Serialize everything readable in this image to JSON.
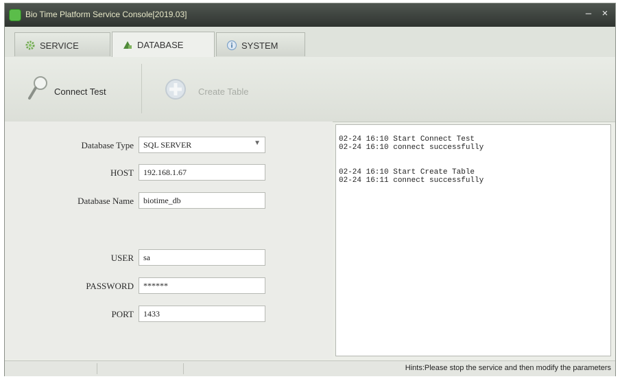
{
  "window": {
    "title": "Bio Time Platform Service Console[2019.03]",
    "minimize_glyph": "–",
    "close_glyph": "×"
  },
  "tabs": [
    {
      "label": "SERVICE",
      "icon": "gear-icon"
    },
    {
      "label": "DATABASE",
      "icon": "database-icon",
      "active": true
    },
    {
      "label": "SYSTEM",
      "icon": "info-icon"
    }
  ],
  "toolbar": {
    "connect_test": "Connect Test",
    "create_table": "Create Table"
  },
  "form": {
    "db_type": {
      "label": "Database Type",
      "value": "SQL SERVER"
    },
    "host": {
      "label": "HOST",
      "value": "192.168.1.67"
    },
    "db_name": {
      "label": "Database Name",
      "value": "biotime_db"
    },
    "user": {
      "label": "USER",
      "value": "sa"
    },
    "password": {
      "label": "PASSWORD",
      "value": "******"
    },
    "port": {
      "label": "PORT",
      "value": "1433"
    }
  },
  "log": {
    "lines": [
      "02-24 16:10 Start Connect Test",
      "02-24 16:10 connect successfully",
      "",
      "",
      "02-24 16:10 Start Create Table",
      "02-24 16:11 connect successfully"
    ]
  },
  "status": {
    "hint": "Hints:Please stop the service and then modify the parameters"
  },
  "colors": {
    "titlebar": "#3a403b",
    "accent_green": "#5bbd4a",
    "panel_bg": "#ebece8"
  }
}
